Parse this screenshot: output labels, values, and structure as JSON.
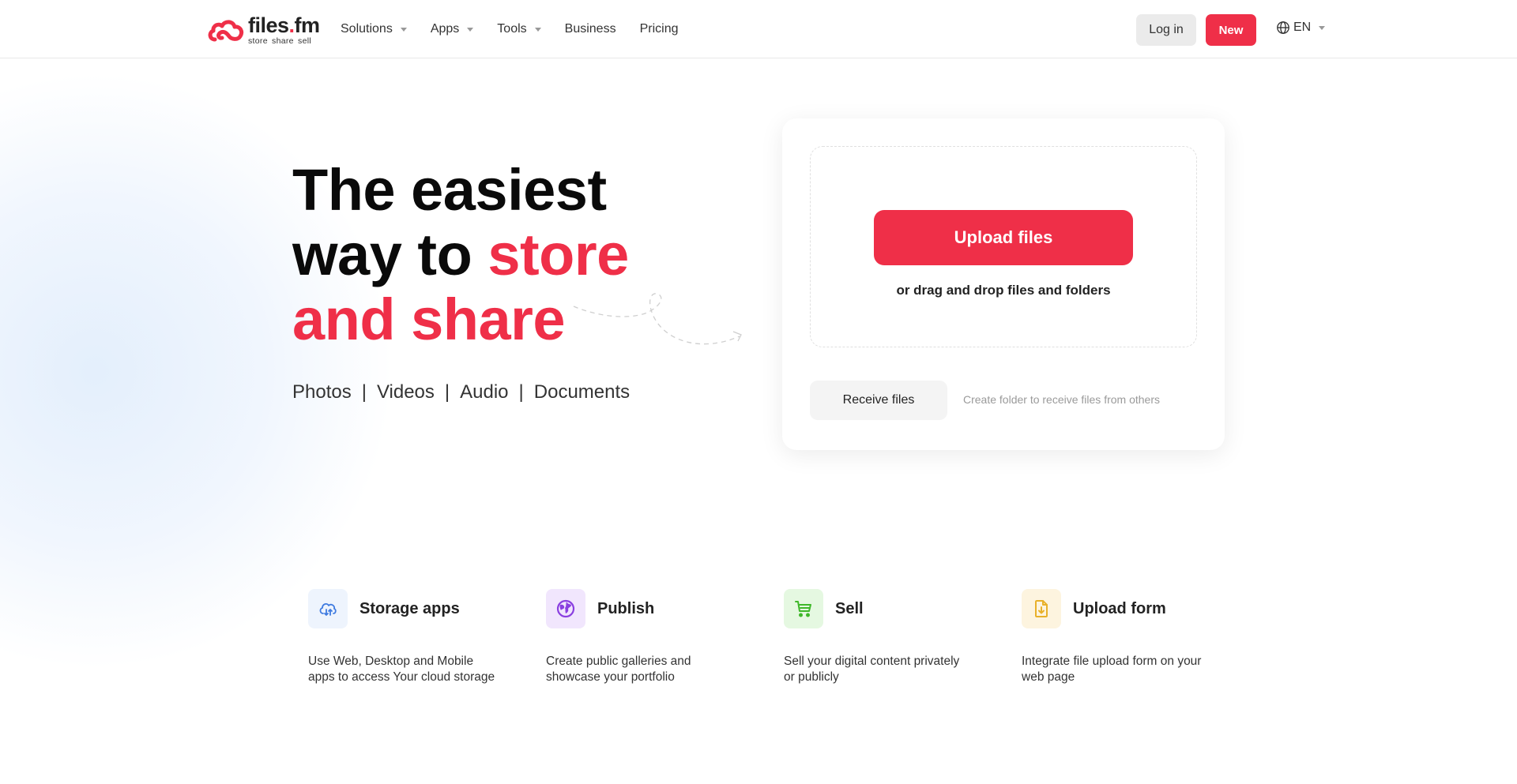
{
  "header": {
    "logo": {
      "name": "files",
      "dot": ".",
      "tld": "fm",
      "tagline": "store share sell"
    },
    "nav": [
      {
        "label": "Solutions",
        "has_dropdown": true
      },
      {
        "label": "Apps",
        "has_dropdown": true
      },
      {
        "label": "Tools",
        "has_dropdown": true
      },
      {
        "label": "Business",
        "has_dropdown": false
      },
      {
        "label": "Pricing",
        "has_dropdown": false
      }
    ],
    "login_label": "Log in",
    "new_label": "New",
    "language": {
      "icon": "globe-icon",
      "value": "EN"
    }
  },
  "hero": {
    "title_line1": "The easiest",
    "title_line2_black": "way to ",
    "title_line2_red": "store",
    "title_line3_red": "and share",
    "formats": [
      "Photos",
      "Videos",
      "Audio",
      "Documents"
    ],
    "format_separator": "|"
  },
  "upload": {
    "upload_label": "Upload files",
    "drag_text": "or drag and drop files and folders",
    "receive_label": "Receive files",
    "receive_hint": "Create folder to receive files from others"
  },
  "features": [
    {
      "icon": "cloud-sync-icon",
      "title": "Storage apps",
      "description": "Use Web, Desktop and Mobile apps to access Your cloud storage",
      "icon_color": "#3f7be0",
      "icon_bg": "#eef4fd"
    },
    {
      "icon": "globe-icon",
      "title": "Publish",
      "description": "Create public galleries and showcase your portfolio",
      "icon_color": "#8a3fe0",
      "icon_bg": "#f1e6fd"
    },
    {
      "icon": "cart-icon",
      "title": "Sell",
      "description": "Sell your digital content privately or publicly",
      "icon_color": "#3fb82a",
      "icon_bg": "#e5f8e1"
    },
    {
      "icon": "file-download-icon",
      "title": "Upload form",
      "description": "Integrate file upload form on your web page",
      "icon_color": "#e8b12a",
      "icon_bg": "#fdf4df"
    }
  ],
  "colors": {
    "brand": "#ef2f48",
    "text": "#222222"
  }
}
